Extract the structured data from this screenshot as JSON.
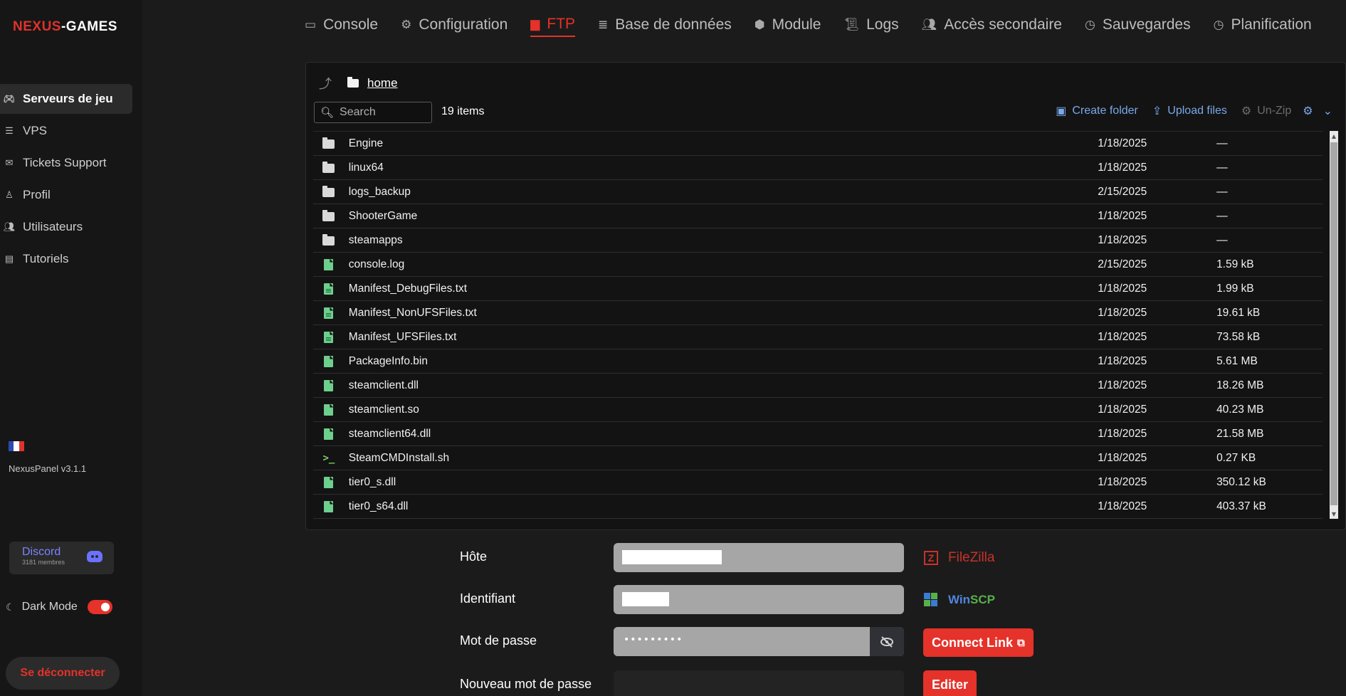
{
  "brand": {
    "part1": "NEXUS",
    "part2": "-GAMES"
  },
  "sidebar": {
    "items": [
      {
        "label": "Serveurs de jeu",
        "icon": "gamepad-icon"
      },
      {
        "label": "VPS",
        "icon": "server-icon"
      },
      {
        "label": "Tickets Support",
        "icon": "ticket-icon"
      },
      {
        "label": "Profil",
        "icon": "user-icon"
      },
      {
        "label": "Utilisateurs",
        "icon": "users-icon"
      },
      {
        "label": "Tutoriels",
        "icon": "book-icon"
      }
    ],
    "version": "NexusPanel v3.1.1",
    "discord": {
      "title": "Discord",
      "members": "3181 membres"
    },
    "dark_mode_label": "Dark Mode",
    "logout_label": "Se déconnecter"
  },
  "tabs": [
    {
      "label": "Console",
      "icon": "console-icon"
    },
    {
      "label": "Configuration",
      "icon": "gears-icon"
    },
    {
      "label": "FTP",
      "icon": "ftp-folder-icon",
      "active": true
    },
    {
      "label": "Base de données",
      "icon": "database-icon"
    },
    {
      "label": "Module",
      "icon": "cube-icon"
    },
    {
      "label": "Logs",
      "icon": "scroll-icon"
    },
    {
      "label": "Accès secondaire",
      "icon": "users-icon"
    },
    {
      "label": "Sauvegardes",
      "icon": "clock-icon"
    },
    {
      "label": "Planification",
      "icon": "clock-icon"
    }
  ],
  "filemanager": {
    "breadcrumb": "home",
    "search_placeholder": "Search",
    "item_count": "19 items",
    "actions": {
      "create_folder": "Create folder",
      "upload_files": "Upload files",
      "unzip": "Un-Zip"
    },
    "files": [
      {
        "name": "Engine",
        "type": "folder",
        "date": "1/18/2025",
        "size": "—"
      },
      {
        "name": "linux64",
        "type": "folder",
        "date": "1/18/2025",
        "size": "—"
      },
      {
        "name": "logs_backup",
        "type": "folder",
        "date": "2/15/2025",
        "size": "—"
      },
      {
        "name": "ShooterGame",
        "type": "folder",
        "date": "1/18/2025",
        "size": "—"
      },
      {
        "name": "steamapps",
        "type": "folder",
        "date": "1/18/2025",
        "size": "—"
      },
      {
        "name": "console.log",
        "type": "file",
        "date": "2/15/2025",
        "size": "1.59 kB"
      },
      {
        "name": "Manifest_DebugFiles.txt",
        "type": "txt",
        "date": "1/18/2025",
        "size": "1.99 kB"
      },
      {
        "name": "Manifest_NonUFSFiles.txt",
        "type": "txt",
        "date": "1/18/2025",
        "size": "19.61 kB"
      },
      {
        "name": "Manifest_UFSFiles.txt",
        "type": "txt",
        "date": "1/18/2025",
        "size": "73.58 kB"
      },
      {
        "name": "PackageInfo.bin",
        "type": "file",
        "date": "1/18/2025",
        "size": "5.61 MB"
      },
      {
        "name": "steamclient.dll",
        "type": "file",
        "date": "1/18/2025",
        "size": "18.26 MB"
      },
      {
        "name": "steamclient.so",
        "type": "file",
        "date": "1/18/2025",
        "size": "40.23 MB"
      },
      {
        "name": "steamclient64.dll",
        "type": "file",
        "date": "1/18/2025",
        "size": "21.58 MB"
      },
      {
        "name": "SteamCMDInstall.sh",
        "type": "shell",
        "date": "1/18/2025",
        "size": "0.27 KB"
      },
      {
        "name": "tier0_s.dll",
        "type": "file",
        "date": "1/18/2025",
        "size": "350.12 kB"
      },
      {
        "name": "tier0_s64.dll",
        "type": "file",
        "date": "1/18/2025",
        "size": "403.37 kB"
      }
    ]
  },
  "credentials": {
    "host_label": "Hôte",
    "user_label": "Identifiant",
    "password_label": "Mot de passe",
    "password_value": "•••••••••",
    "new_password_label": "Nouveau mot de passe",
    "filezilla_label": "FileZilla",
    "winscp_label_part1": "Win",
    "winscp_label_part2": "SCP",
    "connect_link_label": "Connect Link",
    "edit_label": "Editer"
  },
  "colors": {
    "accent": "#e5322a",
    "link": "#79a9ea",
    "file_green": "#6dcf8e",
    "discord": "#7a84ff"
  }
}
